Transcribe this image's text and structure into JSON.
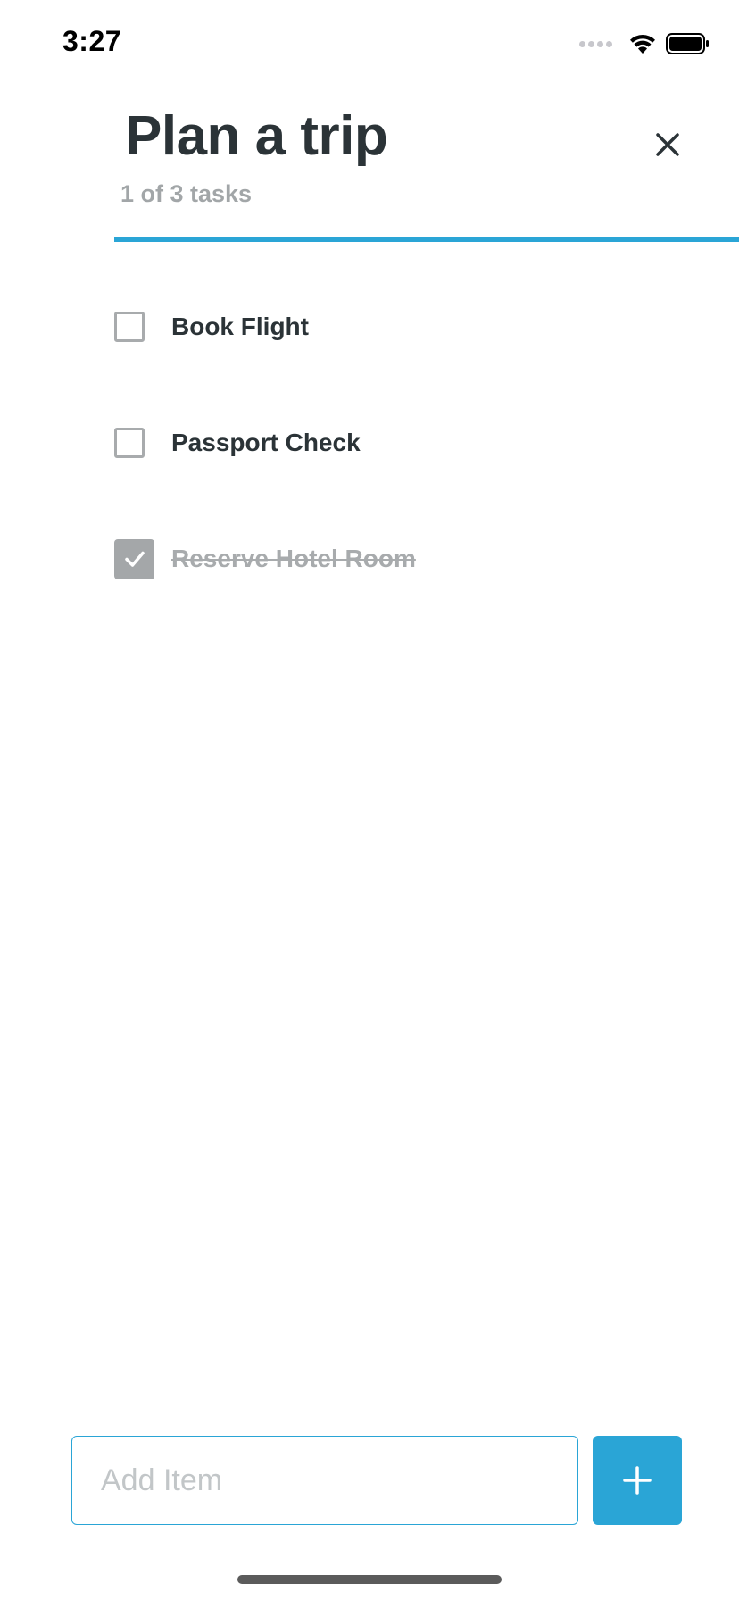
{
  "status_bar": {
    "time": "3:27"
  },
  "header": {
    "title": "Plan a trip",
    "subtitle": "1 of 3 tasks",
    "progress": 1.0
  },
  "tasks": [
    {
      "label": "Book Flight",
      "done": false
    },
    {
      "label": "Passport Check",
      "done": false
    },
    {
      "label": "Reserve Hotel Room",
      "done": true
    }
  ],
  "add_item": {
    "placeholder": "Add Item",
    "value": ""
  },
  "colors": {
    "accent": "#2aa5d6",
    "title_text": "#2b3337",
    "muted_text": "#a2a6a8",
    "checked_box": "#a4a7a9"
  },
  "icons": {
    "close": "close-icon",
    "add": "plus-icon",
    "check": "check-icon",
    "wifi": "wifi-icon",
    "battery": "battery-icon",
    "signal": "signal-icon"
  }
}
